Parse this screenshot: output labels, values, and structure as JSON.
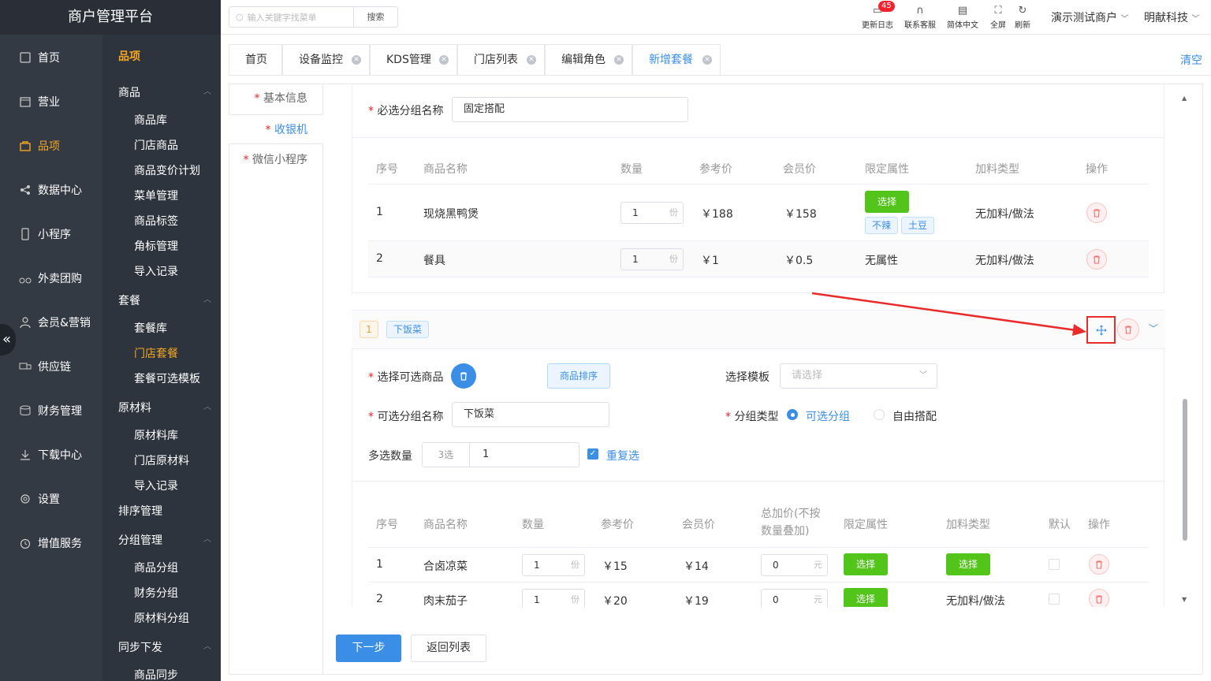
{
  "app": {
    "title": "商户管理平台"
  },
  "nav": {
    "items": [
      {
        "label": "首页",
        "icon": "home-icon"
      },
      {
        "label": "营业",
        "icon": "calendar-icon"
      },
      {
        "label": "品项",
        "icon": "bag-icon"
      },
      {
        "label": "数据中心",
        "icon": "share-icon"
      },
      {
        "label": "小程序",
        "icon": "phone-icon"
      },
      {
        "label": "外卖团购",
        "icon": "bike-icon"
      },
      {
        "label": "会员&营销",
        "icon": "user-icon"
      },
      {
        "label": "供应链",
        "icon": "truck-icon"
      },
      {
        "label": "财务管理",
        "icon": "database-icon"
      },
      {
        "label": "下载中心",
        "icon": "download-icon"
      },
      {
        "label": "设置",
        "icon": "gear-icon"
      },
      {
        "label": "增值服务",
        "icon": "clock-icon"
      }
    ],
    "collapse": "«"
  },
  "subnav": {
    "header": "品项",
    "groups": {
      "g0": "商品",
      "g1": "套餐",
      "g2": "原材料",
      "g3": "排序管理",
      "g4": "分组管理",
      "g5": "同步下发"
    },
    "items": {
      "i0": "商品库",
      "i1": "门店商品",
      "i2": "商品变价计划",
      "i3": "菜单管理",
      "i4": "商品标签",
      "i5": "角标管理",
      "i6": "导入记录",
      "i7": "套餐库",
      "i8": "门店套餐",
      "i9": "套餐可选模板",
      "i10": "原材料库",
      "i11": "门店原材料",
      "i12": "导入记录",
      "i13": "商品分组",
      "i14": "财务分组",
      "i15": "原材料分组",
      "i16": "商品同步"
    }
  },
  "topbar": {
    "search_placeholder": "输入关键字找菜单",
    "search_button": "搜索",
    "badge": "45",
    "icons": {
      "log": "更新日志",
      "service": "联系客服",
      "lang": "简体中文",
      "fullscreen": "全屏",
      "refresh": "刷新"
    },
    "merchant": "演示测试商户",
    "company": "明献科技"
  },
  "tabs": {
    "t0": "首页",
    "t1": "设备监控",
    "t2": "KDS管理",
    "t3": "门店列表",
    "t4": "编辑角色",
    "t5": "新增套餐",
    "clear": "清空"
  },
  "vtabs": {
    "v0": "基本信息",
    "v1": "收银机",
    "v2": "微信小程序",
    "star": "*"
  },
  "form1": {
    "label": "必选分组名称",
    "value": "固定搭配",
    "headers": {
      "h0": "序号",
      "h1": "商品名称",
      "h2": "数量",
      "h3": "参考价",
      "h4": "会员价",
      "h5": "限定属性",
      "h6": "加料类型",
      "h7": "操作"
    },
    "rows": [
      {
        "no": "1",
        "name": "现烧黑鸭煲",
        "qty": "1",
        "unit": "份",
        "ref": "￥188",
        "member": "￥158",
        "attr_btn": "选择",
        "tag1": "不辣",
        "tag2": "土豆",
        "type": "无加料/做法"
      },
      {
        "no": "2",
        "name": "餐具",
        "qty": "1",
        "unit": "份",
        "ref": "￥1",
        "member": "￥0.5",
        "attr": "无属性",
        "type": "无加料/做法"
      }
    ]
  },
  "group2": {
    "index": "1",
    "name_tag": "下饭菜",
    "choose_label": "选择可选商品",
    "sort_btn": "商品排序",
    "template_label": "选择模板",
    "template_placeholder": "请选择",
    "name_label": "可选分组名称",
    "name_value": "下饭菜",
    "type_label": "分组类型",
    "type_opt1": "可选分组",
    "type_opt2": "自由搭配",
    "multi_label": "多选数量",
    "multi_prefix": "3选",
    "multi_value": "1",
    "repeat": "重复选",
    "headers": {
      "h0": "序号",
      "h1": "商品名称",
      "h2": "数量",
      "h3": "参考价",
      "h4": "会员价",
      "h5a": "总加价(不按",
      "h5b": "数量叠加)",
      "h6": "限定属性",
      "h7": "加料类型",
      "h8": "默认",
      "h9": "操作"
    },
    "rows": [
      {
        "no": "1",
        "name": "合卤凉菜",
        "qty": "1",
        "unit": "份",
        "ref": "￥15",
        "member": "￥14",
        "add": "0",
        "add_unit": "元",
        "attr_btn": "选择",
        "type_btn": "选择"
      },
      {
        "no": "2",
        "name": "肉末茄子",
        "qty": "1",
        "unit": "份",
        "ref": "￥20",
        "member": "￥19",
        "add": "0",
        "add_unit": "元",
        "attr_btn": "选择",
        "type": "无加料/做法"
      }
    ]
  },
  "footer": {
    "next": "下一步",
    "back": "返回列表"
  },
  "colors": {
    "accent": "#3a8ee6",
    "nav_active": "#f5a623",
    "danger": "#f5222d",
    "green": "#52c41a"
  }
}
